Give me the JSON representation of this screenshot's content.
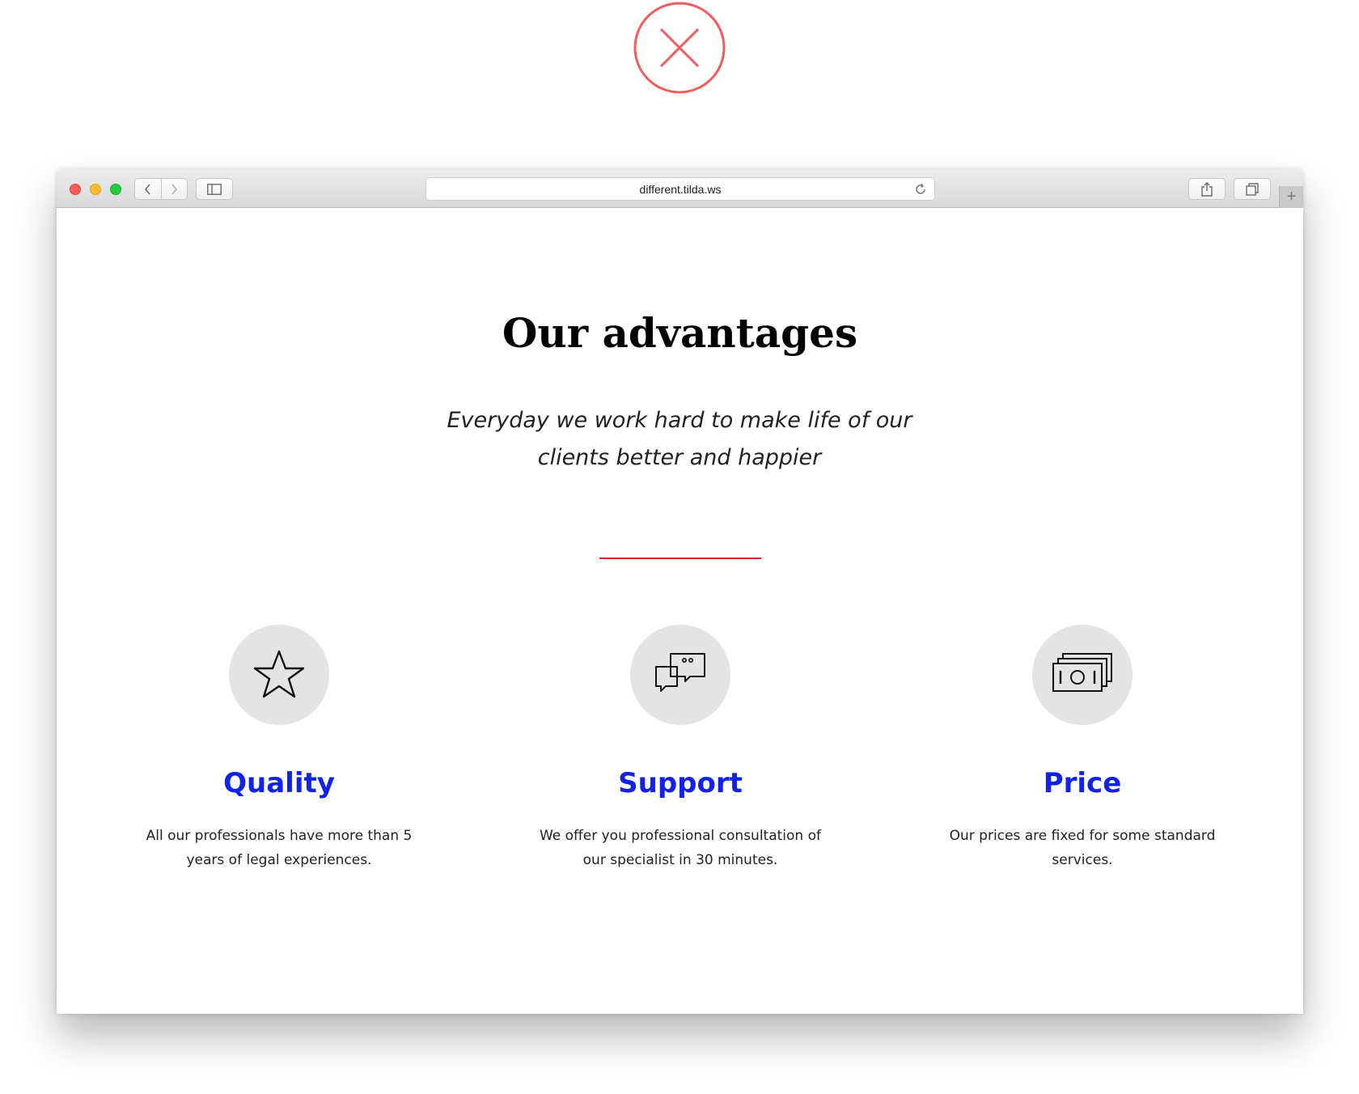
{
  "close_mark": {
    "icon": "close-circle-icon",
    "color": "#f25c5c"
  },
  "browser": {
    "url": "different.tilda.ws",
    "icons": {
      "back": "chevron-left-icon",
      "forward": "chevron-right-icon",
      "sidebar": "sidebar-icon",
      "reload": "reload-icon",
      "share": "share-icon",
      "tabs": "tabs-overview-icon",
      "new_tab": "plus-icon"
    },
    "new_tab_label": "+"
  },
  "page": {
    "title": "Our advantages",
    "subtitle": "Everyday we work hard to make life of our clients better and happier",
    "accent_color": "#e0202a",
    "heading_color": "#1122ee",
    "features": [
      {
        "icon": "star-icon",
        "title": "Quality",
        "text": "All our professionals have more than 5 years of legal experiences."
      },
      {
        "icon": "chat-bubbles-icon",
        "title": "Support",
        "text": "We offer you professional consultation of our specialist in 30 minutes."
      },
      {
        "icon": "money-stack-icon",
        "title": "Price",
        "text": "Our prices are fixed for some standard services."
      }
    ]
  }
}
